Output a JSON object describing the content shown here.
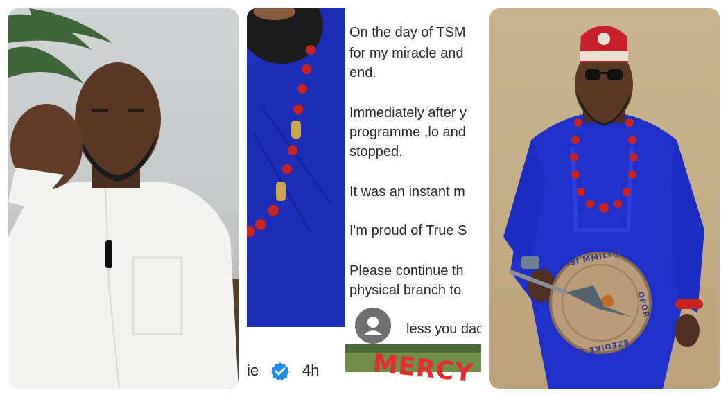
{
  "post": {
    "lines": [
      "On the day of TSM",
      "for my miracle and",
      "end.",
      "Immediately after y",
      "programme ,lo and",
      "stopped.",
      "It was an instant m",
      "I'm proud of True S",
      "Please continue th",
      "physical branch to",
      "less you dad"
    ],
    "author_fragment": "ie",
    "time": "4h",
    "sticker": "MERCY"
  },
  "medallion": {
    "top_text": "ISI MMILI JI",
    "right_text": "OFOR",
    "bottom_text": "EZEDIKE 1"
  },
  "colors": {
    "agbada_white": "#f4f4f2",
    "royal_blue": "#1f2fc8",
    "coral_beads": "#c8231d",
    "cap_red": "#c81f2a",
    "verified_blue": "#1d8df0",
    "sticker_red": "#e52b2b"
  }
}
